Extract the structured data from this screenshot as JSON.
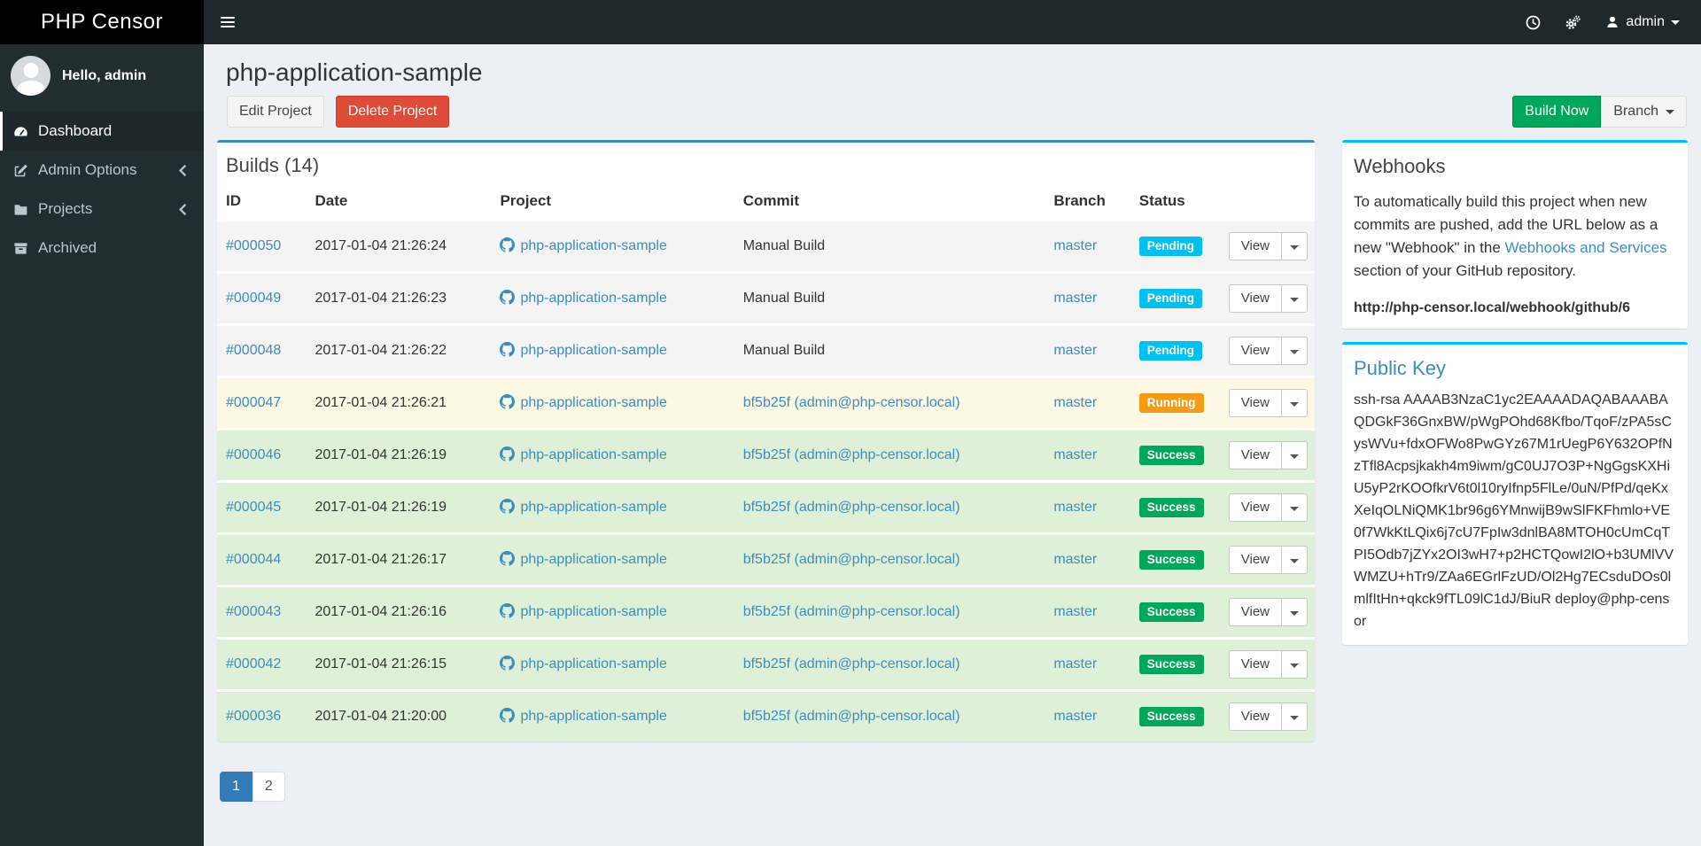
{
  "app": {
    "name": "PHP Censor"
  },
  "navbar": {
    "icons": [
      "clock-icon",
      "cogs-icon"
    ],
    "user": {
      "icon": "user-icon",
      "label": "admin"
    }
  },
  "sidebar": {
    "greeting": "Hello, admin",
    "items": [
      {
        "label": "Dashboard",
        "icon": "dashboard-icon",
        "active": true,
        "has_submenu": false
      },
      {
        "label": "Admin Options",
        "icon": "edit-icon",
        "active": false,
        "has_submenu": true
      },
      {
        "label": "Projects",
        "icon": "folder-icon",
        "active": false,
        "has_submenu": true
      },
      {
        "label": "Archived",
        "icon": "archive-icon",
        "active": false,
        "has_submenu": false
      }
    ]
  },
  "page": {
    "title": "php-application-sample",
    "edit_button": "Edit Project",
    "delete_button": "Delete Project",
    "build_now_button": "Build Now",
    "branch_button": "Branch"
  },
  "builds": {
    "panel_title": "Builds (14)",
    "columns": [
      "ID",
      "Date",
      "Project",
      "Commit",
      "Branch",
      "Status",
      ""
    ],
    "view_label": "View",
    "status_colors": {
      "Pending": "#00c0ef",
      "Running": "#f39c12",
      "Success": "#00a65a"
    },
    "row_colors": {
      "Pending": "#f4f4f4",
      "Running": "#fcf8e3",
      "Success": "#dff0d8"
    },
    "rows": [
      {
        "id": "#000050",
        "date": "2017-01-04 21:26:24",
        "project": "php-application-sample",
        "commit": "Manual Build",
        "commit_is_link": false,
        "branch": "master",
        "status": "Pending"
      },
      {
        "id": "#000049",
        "date": "2017-01-04 21:26:23",
        "project": "php-application-sample",
        "commit": "Manual Build",
        "commit_is_link": false,
        "branch": "master",
        "status": "Pending"
      },
      {
        "id": "#000048",
        "date": "2017-01-04 21:26:22",
        "project": "php-application-sample",
        "commit": "Manual Build",
        "commit_is_link": false,
        "branch": "master",
        "status": "Pending"
      },
      {
        "id": "#000047",
        "date": "2017-01-04 21:26:21",
        "project": "php-application-sample",
        "commit": "bf5b25f (admin@php-censor.local)",
        "commit_is_link": true,
        "branch": "master",
        "status": "Running"
      },
      {
        "id": "#000046",
        "date": "2017-01-04 21:26:19",
        "project": "php-application-sample",
        "commit": "bf5b25f (admin@php-censor.local)",
        "commit_is_link": true,
        "branch": "master",
        "status": "Success"
      },
      {
        "id": "#000045",
        "date": "2017-01-04 21:26:19",
        "project": "php-application-sample",
        "commit": "bf5b25f (admin@php-censor.local)",
        "commit_is_link": true,
        "branch": "master",
        "status": "Success"
      },
      {
        "id": "#000044",
        "date": "2017-01-04 21:26:17",
        "project": "php-application-sample",
        "commit": "bf5b25f (admin@php-censor.local)",
        "commit_is_link": true,
        "branch": "master",
        "status": "Success"
      },
      {
        "id": "#000043",
        "date": "2017-01-04 21:26:16",
        "project": "php-application-sample",
        "commit": "bf5b25f (admin@php-censor.local)",
        "commit_is_link": true,
        "branch": "master",
        "status": "Success"
      },
      {
        "id": "#000042",
        "date": "2017-01-04 21:26:15",
        "project": "php-application-sample",
        "commit": "bf5b25f (admin@php-censor.local)",
        "commit_is_link": true,
        "branch": "master",
        "status": "Success"
      },
      {
        "id": "#000036",
        "date": "2017-01-04 21:20:00",
        "project": "php-application-sample",
        "commit": "bf5b25f (admin@php-censor.local)",
        "commit_is_link": true,
        "branch": "master",
        "status": "Success"
      }
    ]
  },
  "pagination": {
    "pages": [
      {
        "label": "1",
        "active": true
      },
      {
        "label": "2",
        "active": false
      }
    ]
  },
  "webhooks": {
    "title": "Webhooks",
    "text_before_link": "To automatically build this project when new commits are pushed, add the URL below as a new \"Webhook\" in the ",
    "link_text": "Webhooks and Services",
    "text_after_link": " section of your GitHub repository.",
    "url": "http://php-censor.local/webhook/github/6"
  },
  "public_key": {
    "title": "Public Key",
    "key": "ssh-rsa AAAAB3NzaC1yc2EAAAADAQABAAABAQDGkF36GnxBW/pWgPOhd68Kfbo/TqoF/zPA5sCysWVu+fdxOFWo8PwGYz67M1rUegP6Y632OPfNzTfl8Acpsjkakh4m9iwm/gC0UJ7O3P+NgGgsKXHiU5yP2rKOOfkrV6t0l10ryIfnp5FlLe/0uN/PfPd/qeKxXeIqOLNiQMK1br96g6YMnwijB9wSlFKFhmlo+VE0f7WkKtLQix6j7cU7FpIw3dnlBA8MTOH0cUmCqTPI5Odb7jZYx2OI3wH7+p2HCTQowI2lO+b3UMlVVWMZU+hTr9/ZAa6EGrlFzUD/Ol2Hg7ECsduDOs0lmlfItHn+qkck9fTL09lC1dJ/BiuR deploy@php-censor"
  },
  "colors": {
    "logo_bg": "#000000",
    "navbar_bg": "#1e282d",
    "sidebar_bg": "#222d32",
    "content_bg": "#ecf0f5",
    "link": "#3c8dbc",
    "builds_box_border": "#3c8dbc",
    "side_box_border": "#00c0ef",
    "build_now_button": "#00a65a",
    "delete_button": "#dd4b39",
    "pagination_active": "#337ab7"
  }
}
